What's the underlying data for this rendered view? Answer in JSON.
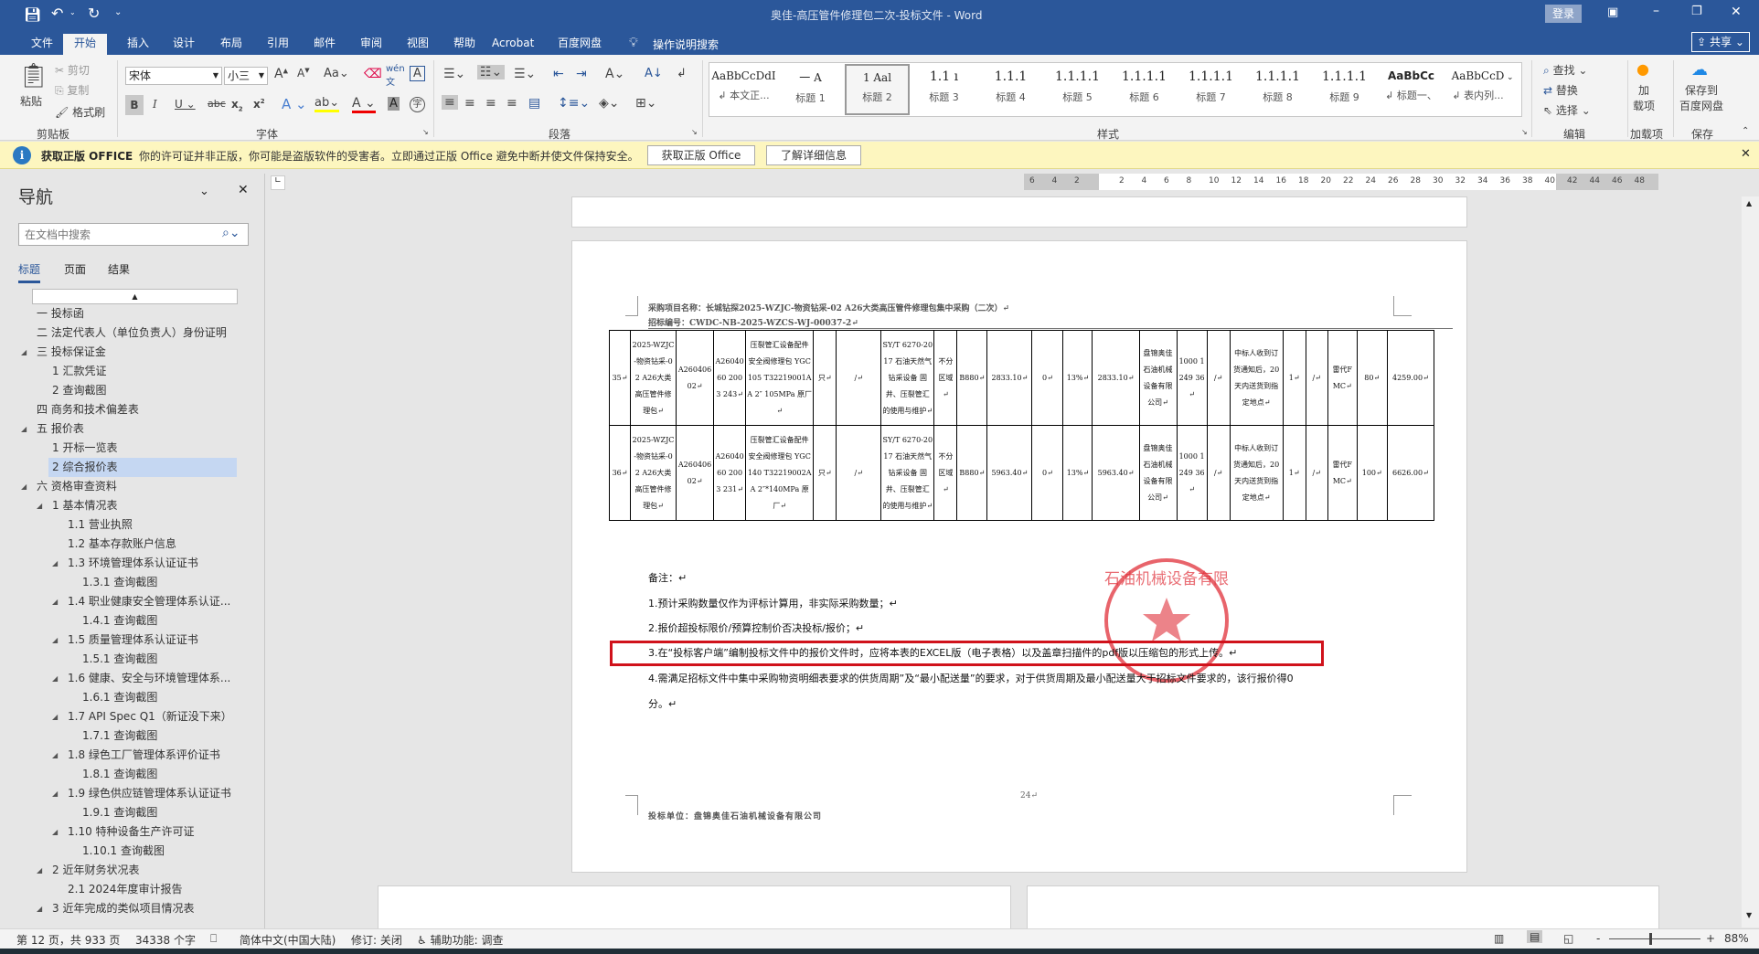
{
  "titlebar": {
    "title": "奥佳-高压管件修理包二次-投标文件  -  Word",
    "login": "登录",
    "share": "共享"
  },
  "tabs": [
    "文件",
    "开始",
    "插入",
    "设计",
    "布局",
    "引用",
    "邮件",
    "审阅",
    "视图",
    "帮助",
    "Acrobat",
    "百度网盘"
  ],
  "tell_me": "操作说明搜索",
  "ribbon": {
    "clipboard": {
      "paste": "粘贴",
      "cut": "剪切",
      "copy": "复制",
      "format_painter": "格式刷",
      "label": "剪贴板"
    },
    "font": {
      "name": "宋体",
      "size": "小三",
      "label": "字体"
    },
    "paragraph": {
      "label": "段落"
    },
    "styles": {
      "label": "样式",
      "items": [
        {
          "preview": "AaBbCcDdI",
          "name": "↲ 本文正..."
        },
        {
          "preview": "一    A",
          "name": "标题 1"
        },
        {
          "preview": "1    Aal",
          "name": "标题 2"
        },
        {
          "preview": "1.1  ı",
          "name": "标题 3"
        },
        {
          "preview": "1.1.1",
          "name": "标题 4"
        },
        {
          "preview": "1.1.1.1",
          "name": "标题 5"
        },
        {
          "preview": "1.1.1.1",
          "name": "标题 6"
        },
        {
          "preview": "1.1.1.1",
          "name": "标题 7"
        },
        {
          "preview": "1.1.1.1",
          "name": "标题 8"
        },
        {
          "preview": "1.1.1.1",
          "name": "标题 9"
        },
        {
          "preview": "AaBbCc",
          "name": "↲ 标题一、"
        },
        {
          "preview": "AaBbCcD",
          "name": "↲ 表内列..."
        }
      ],
      "selected": 2
    },
    "editing": {
      "find": "查找",
      "replace": "替换",
      "select": "选择",
      "label": "编辑"
    },
    "addins": {
      "btn": "加\n载项",
      "label": "加载项"
    },
    "save": {
      "btn": "保存到\n百度网盘",
      "label": "保存"
    }
  },
  "banner": {
    "title": "获取正版 OFFICE",
    "message": "你的许可证并非正版，你可能是盗版软件的受害者。立即通过正版 Office 避免中断并使文件保持安全。",
    "btn1": "获取正版 Office",
    "btn2": "了解详细信息"
  },
  "nav": {
    "title": "导航",
    "search_placeholder": "在文档中搜索",
    "tabs": [
      "标题",
      "页面",
      "结果"
    ],
    "active_tab": 0,
    "items": [
      {
        "level": 0,
        "text": "一 投标函"
      },
      {
        "level": 0,
        "text": "二 法定代表人（单位负责人）身份证明"
      },
      {
        "level": 0,
        "text": "三 投标保证金",
        "expanded": true
      },
      {
        "level": 1,
        "text": "1 汇款凭证"
      },
      {
        "level": 1,
        "text": "2 查询截图"
      },
      {
        "level": 0,
        "text": "四 商务和技术偏差表"
      },
      {
        "level": 0,
        "text": "五 报价表",
        "expanded": true
      },
      {
        "level": 1,
        "text": "1 开标一览表"
      },
      {
        "level": 1,
        "text": "2 综合报价表",
        "selected": true
      },
      {
        "level": 0,
        "text": "六 资格审查资料",
        "expanded": true
      },
      {
        "level": 1,
        "text": "1 基本情况表",
        "expanded": true
      },
      {
        "level": 2,
        "text": "1.1 营业执照"
      },
      {
        "level": 2,
        "text": "1.2 基本存款账户信息"
      },
      {
        "level": 2,
        "text": "1.3 环境管理体系认证证书",
        "expanded": true
      },
      {
        "level": 3,
        "text": "1.3.1 查询截图"
      },
      {
        "level": 2,
        "text": "1.4 职业健康安全管理体系认证...",
        "expanded": true
      },
      {
        "level": 3,
        "text": "1.4.1 查询截图"
      },
      {
        "level": 2,
        "text": "1.5 质量管理体系认证证书",
        "expanded": true
      },
      {
        "level": 3,
        "text": "1.5.1 查询截图"
      },
      {
        "level": 2,
        "text": "1.6 健康、安全与环境管理体系...",
        "expanded": true
      },
      {
        "level": 3,
        "text": "1.6.1 查询截图"
      },
      {
        "level": 2,
        "text": "1.7 API Spec Q1（新证没下来）",
        "expanded": true
      },
      {
        "level": 3,
        "text": "1.7.1 查询截图"
      },
      {
        "level": 2,
        "text": "1.8 绿色工厂管理体系评价证书",
        "expanded": true
      },
      {
        "level": 3,
        "text": "1.8.1 查询截图"
      },
      {
        "level": 2,
        "text": "1.9 绿色供应链管理体系认证证书",
        "expanded": true
      },
      {
        "level": 3,
        "text": "1.9.1 查询截图"
      },
      {
        "level": 2,
        "text": "1.10 特种设备生产许可证",
        "expanded": true
      },
      {
        "level": 3,
        "text": "1.10.1 查询截图"
      },
      {
        "level": 1,
        "text": "2 近年财务状况表",
        "expanded": true
      },
      {
        "level": 2,
        "text": "2.1 2024年度审计报告"
      },
      {
        "level": 1,
        "text": "3 近年完成的类似项目情况表",
        "expanded": true
      }
    ]
  },
  "ruler": {
    "ticks": [
      "6",
      "4",
      "2",
      "",
      "2",
      "4",
      "6",
      "8",
      "10",
      "12",
      "14",
      "16",
      "18",
      "20",
      "22",
      "24",
      "26",
      "28",
      "30",
      "32",
      "34",
      "36",
      "38",
      "40",
      "42",
      "44",
      "46",
      "48"
    ]
  },
  "document": {
    "header_line1": "采购项目名称：长城钻探2025-WZJC-物资钻采-02 A26大类高压管件修理包集中采购（二次）↵",
    "header_line2": "招标编号：CWDC-NB-2025-WZCS-WJ-00037-2↵",
    "rows": [
      [
        "35↵",
        "2025-WZJC-物资钻采-02 A26大类高压管件修理包↵",
        "A26040602↵",
        "A2604060 2003 243↵",
        "压裂管汇设备配件 安全阀修理包 YGC105 T32219001AA 2″ 105MPa 原厂↵",
        "只↵",
        "/↵",
        "SY/T 6270-2017 石油天然气钻采设备 固井、压裂管汇的使用与维护↵",
        "不分区域↵",
        "B880↵",
        "2833.10↵",
        "0↵",
        "13%↵",
        "2833.10↵",
        "盘锦奥佳石油机械设备有限公司↵",
        "1000 1249 36↵",
        "/↵",
        "中标人收到订货通知后，20天内送货到指定地点↵",
        "1↵",
        "/↵",
        "雷代FMC↵",
        "80↵",
        "4259.00↵"
      ],
      [
        "36↵",
        "2025-WZJC-物资钻采-02 A26大类高压管件修理包↵",
        "A26040602↵",
        "A2604060 2003 231↵",
        "压裂管汇设备配件 安全阀修理包 YGC140 T32219002AA 2″*140MPa 原厂↵",
        "只↵",
        "/↵",
        "SY/T 6270-2017 石油天然气钻采设备 固井、压裂管汇的使用与维护↵",
        "不分区域↵",
        "B880↵",
        "5963.40↵",
        "0↵",
        "13%↵",
        "5963.40↵",
        "盘锦奥佳石油机械设备有限公司↵",
        "1000 1249 36↵",
        "/↵",
        "中标人收到订货通知后，20天内送货到指定地点↵",
        "1↵",
        "/↵",
        "雷代FMC↵",
        "100↵",
        "6626.00↵"
      ]
    ],
    "notes_title": "备注：↵",
    "notes": [
      "1.预计采购数量仅作为评标计算用，非实际采购数量；↵",
      "2.报价超投标限价/预算控制价否决投标/报价；↵",
      "3.在“投标客户端”编制投标文件中的报价文件时，应将本表的EXCEL版（电子表格）以及盖章扫描件的pdf版以压缩包的形式上传。↵",
      "4.需满足招标文件中集中采购物资明细表要求的供货周期”及“最小配送量”的要求，对于供货周期及最小配送量大于招标文件要求的，该行报价得0",
      "分。↵"
    ],
    "page_number": "24↵",
    "footer": "投标单位：盘锦奥佳石油机械设备有限公司",
    "highlight_color": "#d0121b",
    "stamp_color": "#e0303a"
  },
  "status": {
    "page": "第 12 页，共 933 页",
    "words": "34338 个字",
    "language": "简体中文(中国大陆)",
    "track": "修订: 关闭",
    "accessibility": "辅助功能: 调查",
    "zoom": "88%"
  },
  "colors": {
    "brand": "#2b579a",
    "banner": "#fdf6bf",
    "nav_selected": "#c5d7f2"
  }
}
